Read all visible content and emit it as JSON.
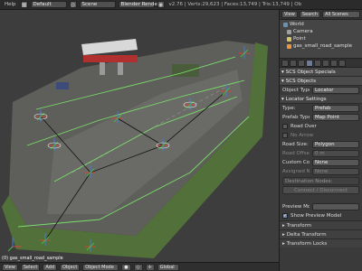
{
  "topbar": {
    "help": "Help",
    "layout": "Default",
    "scene": "Scene",
    "engine": "Blender Render",
    "stats": "v2.76 | Verts:29,623 | Faces:13,749 | Tris:13,749 | Ob"
  },
  "outliner": {
    "view": "View",
    "search": "Search",
    "all_scenes": "All Scenes",
    "items": [
      {
        "label": "World",
        "color": "#6b8fb5"
      },
      {
        "label": "Camera",
        "color": "#9aa0a6"
      },
      {
        "label": "Point",
        "color": "#d6c36a"
      },
      {
        "label": "gas_small_road_sample",
        "color": "#e89a3c"
      }
    ]
  },
  "props": {
    "scs_specials": "SCS Object Specials",
    "scs_objects": "SCS Objects",
    "object_type_label": "Object Type:",
    "object_type_value": "Locator",
    "locator_settings": "Locator Settings",
    "type_label": "Type:",
    "type_value": "Prefab",
    "prefab_type_label": "Prefab Type:",
    "prefab_type_value": "Map Point",
    "road_over": "Road Over",
    "no_arrow": "No Arrow",
    "road_size_label": "Road Size:",
    "road_size_value": "Polygon",
    "road_offset_label": "Road Offset:",
    "road_offset_value": "0 m",
    "custom_color_label": "Custom Color:",
    "custom_color_value": "None",
    "assigned_node_label": "Assigned Node:",
    "assigned_node_value": "None",
    "destination_nodes": "Destination Nodes:",
    "connect_btn": "Connect / Disconnect",
    "preview_model_label": "Preview Model:",
    "show_preview": "Show Preview Model",
    "transform": "Transform",
    "delta_transform": "Delta Transform",
    "transform_locks": "Transform Locks"
  },
  "bottombar": {
    "view": "View",
    "select": "Select",
    "add": "Add",
    "object": "Object",
    "mode": "Object Mode",
    "orientation": "Global"
  },
  "viewport": {
    "label": "(0) gas_small_road_sample"
  },
  "colors": {
    "accent": "#6f86ad",
    "road": "#5e5e5a",
    "grass": "#52703a",
    "curve_green": "#7adf6a"
  }
}
